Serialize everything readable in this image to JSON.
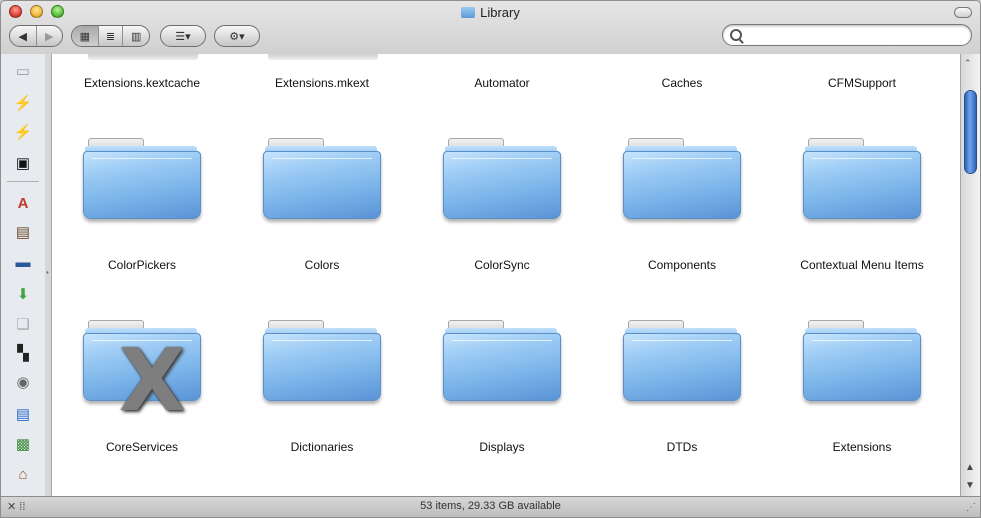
{
  "window": {
    "title": "Library"
  },
  "toolbar": {
    "back_icon": "◀",
    "forward_icon": "▶",
    "view_icon": "▦",
    "view_list": "≣",
    "view_columns": "▥",
    "arrange_icon": "☰▾",
    "action_icon": "⚙▾",
    "search_placeholder": ""
  },
  "sidebar": {
    "items": [
      {
        "icon": "▭",
        "color": "#9a9a9a"
      },
      {
        "icon": "⚡",
        "color": "#f0a12a"
      },
      {
        "icon": "⚡",
        "color": "#f0a12a"
      },
      {
        "icon": "▣",
        "color": "#111111"
      },
      {
        "icon": "A",
        "color": "#c0392b"
      },
      {
        "icon": "▤",
        "color": "#6a4a2a"
      },
      {
        "icon": "▬",
        "color": "#2a5a9a"
      },
      {
        "icon": "⬇",
        "color": "#3fa53f"
      },
      {
        "icon": "❏",
        "color": "#aaaaaa"
      },
      {
        "icon": "▚",
        "color": "#222222"
      },
      {
        "icon": "◉",
        "color": "#666666"
      },
      {
        "icon": "▤",
        "color": "#2a6ac9"
      },
      {
        "icon": "▩",
        "color": "#3a8a3a"
      },
      {
        "icon": "⌂",
        "color": "#a0522d"
      }
    ]
  },
  "files": {
    "row1": [
      "Extensions.kextcache",
      "Extensions.mkext",
      "Automator",
      "Caches",
      "CFMSupport"
    ],
    "row2": [
      "ColorPickers",
      "Colors",
      "ColorSync",
      "Components",
      "Contextual Menu Items"
    ],
    "row3": [
      "CoreServices",
      "Dictionaries",
      "Displays",
      "DTDs",
      "Extensions"
    ]
  },
  "x_badge": "X",
  "status": {
    "text": "53 items, 29.33 GB available"
  }
}
